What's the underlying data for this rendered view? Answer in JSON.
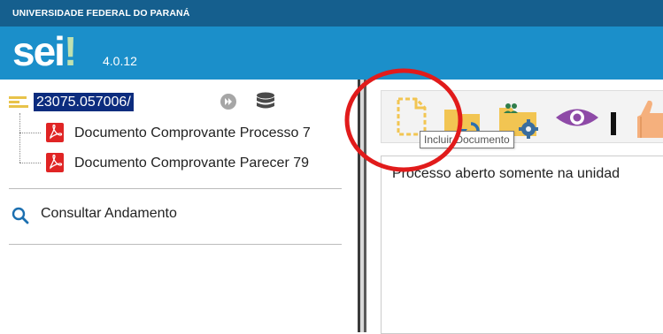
{
  "header": {
    "institution": "UNIVERSIDADE FEDERAL DO PARANÁ",
    "logo_text": "sei",
    "logo_mark": "!",
    "version": "4.0.12"
  },
  "tree": {
    "process_number": "23075.057006/",
    "documents": [
      {
        "label": "Documento Comprovante Processo 7",
        "icon": "pdf-icon"
      },
      {
        "label": "Documento Comprovante Parecer 79",
        "icon": "pdf-icon"
      }
    ],
    "consult_label": "Consultar Andamento"
  },
  "toolbar": {
    "buttons": [
      "include-document-icon",
      "folder-reopen-icon",
      "folder-users-settings-icon",
      "eye-icon",
      "black-bar-icon",
      "thumbs-up-icon"
    ],
    "tooltip": "Incluir Documento"
  },
  "content": {
    "message": "Processo aberto somente na unidad"
  },
  "colors": {
    "topbar": "#155f8e",
    "header": "#1b8fca",
    "selection": "#0c2c7e",
    "pdf": "#e02424",
    "annotation_circle": "#e11b1b",
    "folder": "#f2c552"
  }
}
